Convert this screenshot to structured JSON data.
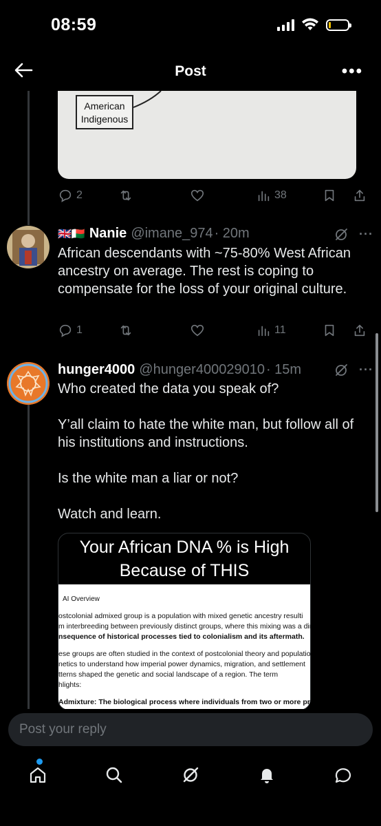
{
  "status_bar": {
    "time": "08:59"
  },
  "header": {
    "title": "Post"
  },
  "first_post_image": {
    "diagram_label": "American Indigenous"
  },
  "first_post_actions": {
    "replies": "2",
    "views": "38"
  },
  "tweets": [
    {
      "flags": "🇬🇧🇲🇬",
      "name": "Nanie",
      "handle": "@imane_974",
      "time": "· 20m",
      "text": "African descendants with ~75-80% West African ancestry on average. The rest is coping to compensate for the loss of your original culture.",
      "replies": "1",
      "views": "11"
    },
    {
      "name": "hunger4000",
      "handle": "@hunger400029010",
      "time": "· 15m",
      "text": "Who created the data you speak of?\n\nY’all claim to hate the white man, but follow all of his institutions and instructions.\n\nIs the white man a liar or not?\n\nWatch and learn.",
      "media": {
        "title": "Your African DNA % is High Because of THIS",
        "doc_heading": "AI Overview",
        "lines": [
          "ostcolonial admixed group is a population with mixed genetic ancestry resulti",
          "m interbreeding between previously distinct groups, where this mixing was a dir",
          "nsequence of historical processes tied to colonialism and its aftermath.",
          "ese groups are often studied in the context of postcolonial theory and populatio",
          "netics to understand how imperial power dynamics, migration, and settlement",
          "tterns shaped the genetic and social landscape of a region. The term",
          "hlights:",
          "Admixture: The biological process where individuals from two or more previous"
        ]
      }
    }
  ],
  "reply": {
    "placeholder": "Post your reply"
  },
  "colors": {
    "accent": "#1d9bf0",
    "background": "#000000",
    "muted": "#71767b"
  }
}
